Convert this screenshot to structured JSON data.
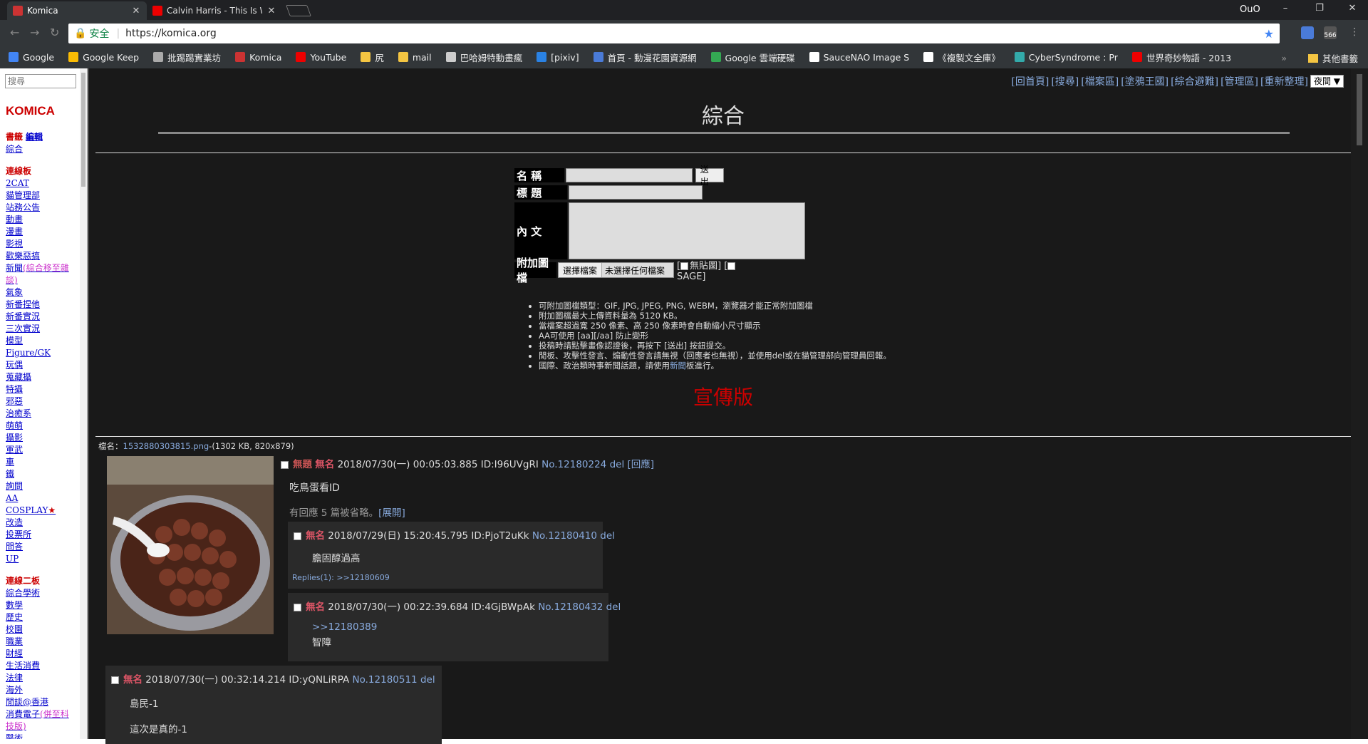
{
  "browser": {
    "tabs": [
      {
        "title": "Komica",
        "active": true
      },
      {
        "title": "Calvin Harris - This Is Wh",
        "active": false
      }
    ],
    "profile": "OuO",
    "window_buttons": [
      "–",
      "❐",
      "✕"
    ],
    "address": {
      "secure_label": "安全",
      "url": "https://komica.org"
    },
    "ext_badge": "566",
    "bookmarks": [
      "Google",
      "Google Keep",
      "批踢踢實業坊",
      "Komica",
      "YouTube",
      "尻",
      "mail",
      "巴哈姆特動畫瘋",
      "[pixiv]",
      "首頁 - 動漫花園資源網",
      "Google 雲端硬碟",
      "SauceNAO Image S",
      "《複製文全庫》",
      "CyberSyndrome : Pr",
      "世界奇妙物語 - 2013"
    ],
    "bookmarks_overflow": "»",
    "bookmarks_other": "其他書籤"
  },
  "left": {
    "search_placeholder": "搜尋",
    "logo": "KOMICA",
    "groups": [
      {
        "items": [
          {
            "t": "書籤",
            "hd": true
          },
          {
            "t": "編輯"
          },
          {
            "t": "綜合"
          }
        ]
      },
      {
        "items": [
          {
            "t": "連線板",
            "hd": true
          },
          {
            "t": "2CAT"
          },
          {
            "t": "貓管理部"
          },
          {
            "t": "站務公告"
          },
          {
            "t": "動畫"
          },
          {
            "t": "漫畫"
          },
          {
            "t": "影視"
          },
          {
            "t": "歡樂惡搞"
          },
          {
            "t": "新聞",
            "extra": "(綜合移至雜談)"
          },
          {
            "t": "氣象"
          },
          {
            "t": "新番捏他"
          },
          {
            "t": "新番實況"
          },
          {
            "t": "三次實況"
          },
          {
            "t": "模型"
          },
          {
            "t": "Figure/GK"
          },
          {
            "t": "玩偶"
          },
          {
            "t": "蒐藏攝"
          },
          {
            "t": "特攝"
          },
          {
            "t": "邪惡"
          },
          {
            "t": "治癒系"
          },
          {
            "t": "萌萌"
          },
          {
            "t": "攝影"
          },
          {
            "t": "軍武"
          },
          {
            "t": "車"
          },
          {
            "t": "鐵"
          },
          {
            "t": "詢問"
          },
          {
            "t": "AA"
          },
          {
            "t": "COSPLAY",
            "star": "★"
          },
          {
            "t": "改造"
          },
          {
            "t": "投票所"
          },
          {
            "t": "問答"
          },
          {
            "t": "UP"
          }
        ]
      },
      {
        "items": [
          {
            "t": "連線二板",
            "hd": true
          },
          {
            "t": "綜合學術"
          },
          {
            "t": "數學"
          },
          {
            "t": "歷史"
          },
          {
            "t": "校園"
          },
          {
            "t": "職業"
          },
          {
            "t": "財經"
          },
          {
            "t": "生活消費"
          },
          {
            "t": "法律"
          },
          {
            "t": "海外"
          },
          {
            "t": "閒談@香港"
          },
          {
            "t": "消費電子",
            "extra": "(併至科技版)"
          },
          {
            "t": "醫術"
          }
        ]
      }
    ]
  },
  "board": {
    "toplinks": [
      "[回首頁]",
      "[搜尋]",
      "[檔案區]",
      "[塗鴉王國]",
      "[綜合避難]",
      "[管理區]",
      "[重新整理]"
    ],
    "night_select": "夜間 ▼",
    "title": "綜合",
    "form": {
      "name_label": "名 稱",
      "subject_label": "標 題",
      "body_label": "內 文",
      "file_label": "附加圖檔",
      "submit": "送 出",
      "choose_file": "選擇檔案",
      "no_file": "未選擇任何檔案",
      "noimg": "無貼圖",
      "sage": "SAGE"
    },
    "rules": [
      "可附加圖檔類型：GIF, JPG, JPEG, PNG, WEBM，瀏覽器才能正常附加圖檔",
      "附加圖檔最大上傳資料量為 5120 KB。",
      "當檔案超過寬 250 像素、高 250 像素時會自動縮小尺寸顯示",
      "AA可使用 [aa][/aa] 防止變形",
      "投稿時請點擊畫像認證後，再按下 [送出] 按鈕提交。",
      "閒板、攻擊性發言、煽動性發言請無視（回應者也無視），並使用del或在貓管理部向管理員回報。"
    ],
    "rule_last": {
      "pre": "國際、政治類時事新聞話題，請使用",
      "link": "新聞",
      "post": "板進行。"
    },
    "promo": "宣傳版"
  },
  "thread": {
    "file_label": "檔名：",
    "file_name": "1532880303815.png",
    "file_meta": "-(1302 KB, 820x879)",
    "op": {
      "title": "無題",
      "name": "無名",
      "date": "2018/07/30(一) 00:05:03.885 ID:I96UVgRI",
      "no": "No.12180224",
      "del": "del",
      "reply": "[回應]",
      "body": "吃鳥蛋看ID",
      "omitted": "有回應 5 篇被省略。",
      "expand": "[展開]"
    },
    "replies": [
      {
        "name": "無名",
        "date": "2018/07/29(日) 15:20:45.795 ID:PjoT2uKk",
        "no": "No.12180410",
        "del": "del",
        "body": "膽固醇過高",
        "replies_label": "Replies(1):",
        "replies_link": ">>12180609"
      },
      {
        "name": "無名",
        "date": "2018/07/30(一) 00:22:39.684 ID:4GjBWpAk",
        "no": "No.12180432",
        "del": "del",
        "quote": ">>12180389",
        "body": "智障"
      },
      {
        "name": "無名",
        "date": "2018/07/30(一) 00:32:14.214 ID:yQNLiRPA",
        "no": "No.12180511",
        "del": "del",
        "body": "島民-1",
        "body2": "這次是真的-1"
      }
    ]
  }
}
